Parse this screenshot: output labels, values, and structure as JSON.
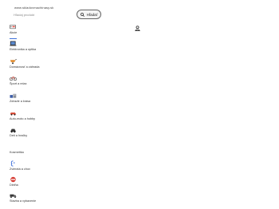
{
  "header": {
    "site_url": "www.skladovmachinasy.sk"
  },
  "search": {
    "placeholder": "Hľadaj produkt",
    "button_label": "Hľadať"
  },
  "categories": [
    {
      "label": "Akcie",
      "icon": "sale-tag-icon"
    },
    {
      "label": "Elektronika a optika",
      "icon": "laptop-icon"
    },
    {
      "label": "Domácnosť a záhrada",
      "icon": "wheelbarrow-icon"
    },
    {
      "label": "Šport a relax",
      "icon": "bicycle-icon"
    },
    {
      "label": "Zdravie a krása",
      "icon": "boxes-icon"
    },
    {
      "label": "Auto-moto a hobby",
      "icon": "car-icon"
    },
    {
      "label": "Deti a hračky",
      "icon": "car-tire-icon"
    },
    {
      "label": "Kosmetika",
      "icon": "bottle-icon"
    },
    {
      "label": "Zvieratá a chov",
      "icon": "paw-icon"
    },
    {
      "label": "Dielňa",
      "icon": "tools-icon"
    },
    {
      "label": "Stavba a vybavenie",
      "icon": "truck-icon"
    }
  ],
  "colors": {
    "accent": "#3d6fd9",
    "text": "#333333",
    "button_border": "#666666"
  }
}
